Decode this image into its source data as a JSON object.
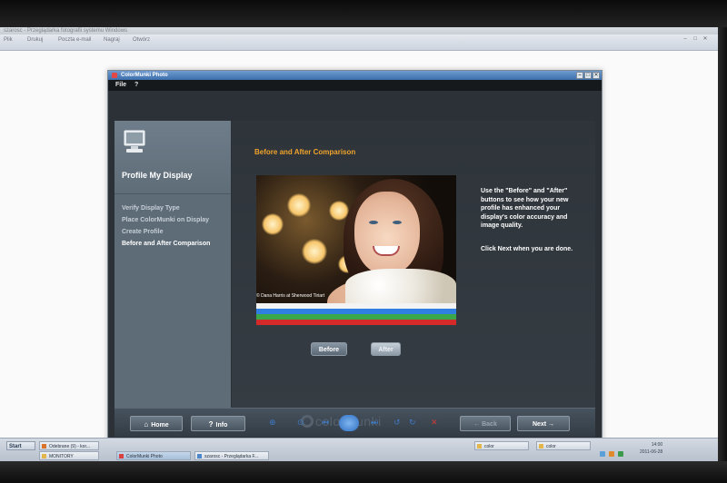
{
  "viewer": {
    "title": "szarosc - Przeglądarka fotografii systemu Windows",
    "toolbar_items": [
      "Plik",
      "Drukuj",
      "Poczta e-mail",
      "Nagraj",
      "Otwórz"
    ]
  },
  "colormunki": {
    "window_title": "ColorMunki Photo",
    "menu": {
      "file": "File",
      "help": "?"
    },
    "left_panel": {
      "title": "Profile My Display",
      "steps": [
        "Verify Display Type",
        "Place ColorMunki on Display",
        "Create Profile",
        "Before and After Comparison"
      ]
    },
    "main": {
      "heading": "Before and After Comparison",
      "photo_credit": "© Dana Harris at Sherwood Tiriart",
      "description": "Use the \"Before\" and \"After\" buttons to see how your new profile has enhanced your display's color accuracy and image quality.",
      "next_hint": "Click Next when you are done.",
      "before_label": "Before",
      "after_label": "After"
    },
    "footer": {
      "home_label": "Home",
      "info_label": "Info",
      "logo_text": "colormunki",
      "back_label": "← Back",
      "next_label": "Next →"
    },
    "color_bars": [
      "#f3f3f3",
      "#2f7fe0",
      "#3aa84a",
      "#d42a2a"
    ]
  },
  "taskbar": {
    "start_label": "Start",
    "tasks": [
      "Odebrane (9) - kor...",
      "MONITORY",
      "ColorMunki Photo",
      "szarosc - Przeglądarka F..."
    ],
    "folders": [
      "color",
      "color"
    ],
    "clock_time": "14:00",
    "clock_date": "2011-06-28"
  }
}
